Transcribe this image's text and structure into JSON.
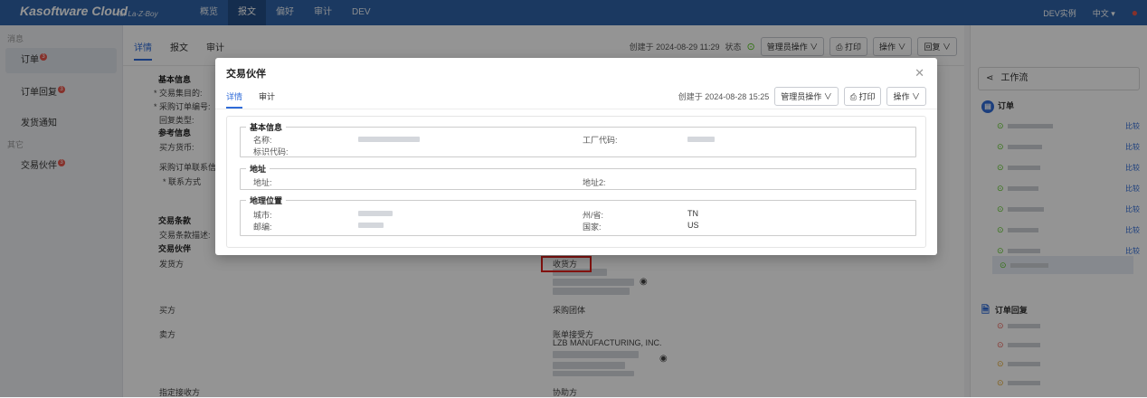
{
  "topbar": {
    "brand": "Kasoftware Cloud",
    "brand_sub": "for La-Z-Boy",
    "nav": [
      "概览",
      "报文",
      "偏好",
      "审计",
      "DEV"
    ],
    "active_nav": "报文",
    "env": "DEV实例",
    "language": "中文 ▾"
  },
  "sidebar": {
    "group1": "消息",
    "items": [
      {
        "label": "订单",
        "badge": "3"
      },
      {
        "label": "订单回复",
        "badge": "3"
      },
      {
        "label": "发货通知",
        "badge": ""
      }
    ],
    "group2": "其它",
    "items2": [
      {
        "label": "交易伙伴",
        "badge": "3"
      }
    ]
  },
  "main": {
    "tabs": [
      "详情",
      "报文",
      "审计"
    ],
    "created": "创建于 2024-08-29 11:29",
    "status_label": "状态",
    "buttons": {
      "admin": "管理员操作 ∨",
      "print": "打印",
      "actions": "操作 ∨",
      "reply": "回复 ∨"
    },
    "bg": {
      "basic_info": "基本信息",
      "trade_purpose": "* 交易集目的:",
      "po_number": "* 采购订单编号:",
      "reply_type": "回复类型:",
      "ref_info": "参考信息",
      "buyer_currency": "买方货币:",
      "po_contact": "采购订单联系信",
      "contact_method": "* 联系方式",
      "trade_terms": "交易条款",
      "terms_desc": "交易条款描述:",
      "partners": "交易伙伴",
      "ship_from": "发货方",
      "ship_to": "收货方",
      "buyer": "买方",
      "buying_group": "采购团体",
      "seller": "卖方",
      "bill_to": "账单接受方",
      "lzb": "LZB MANUFACTURING, INC.",
      "designated_receiver": "指定接收方",
      "co_party": "协助方"
    }
  },
  "workflow": {
    "header": "工作流",
    "order_title": "订单",
    "reply_title": "订单回复",
    "compare": "比较"
  },
  "modal": {
    "title": "交易伙伴",
    "tabs": [
      "详情",
      "审计"
    ],
    "created": "创建于 2024-08-28 15:25",
    "buttons": {
      "admin": "管理员操作 ∨",
      "print": "打印",
      "actions": "操作 ∨"
    },
    "sections": {
      "basic": "基本信息",
      "address": "地址",
      "geo": "地理位置"
    },
    "fields": {
      "name": "名称:",
      "factory_code": "工厂代码:",
      "id_code": "标识代码:",
      "address": "地址:",
      "address2": "地址2:",
      "city": "城市:",
      "state": "州/省:",
      "state_value": "TN",
      "zip": "邮编:",
      "country": "国家:",
      "country_value": "US"
    }
  },
  "colors": {
    "primary": "#2f63a7",
    "accent": "#2f6bd8",
    "badge": "#e7554b",
    "highlight": "#e0201b",
    "ok": "#52c41a"
  }
}
